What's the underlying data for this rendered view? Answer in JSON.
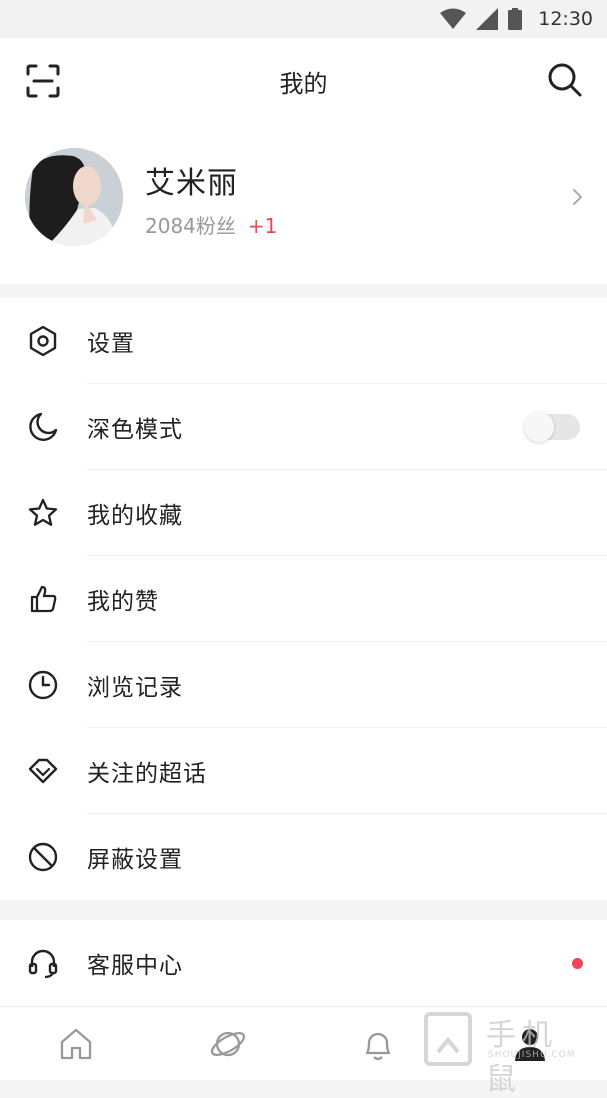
{
  "status_bar": {
    "time": "12:30",
    "icons": [
      "wifi-icon",
      "signal-icon",
      "battery-icon"
    ]
  },
  "header": {
    "title": "我的",
    "left_icon": "scan-icon",
    "right_icon": "search-icon"
  },
  "profile": {
    "name": "艾米丽",
    "followers": "2084粉丝",
    "followers_delta": "+1"
  },
  "menu": [
    {
      "label": "设置",
      "icon": "hexagon-settings-icon"
    },
    {
      "label": "深色模式",
      "icon": "moon-icon",
      "toggle_on": false
    },
    {
      "label": "我的收藏",
      "icon": "star-icon"
    },
    {
      "label": "我的赞",
      "icon": "thumbs-up-icon"
    },
    {
      "label": "浏览记录",
      "icon": "clock-icon"
    },
    {
      "label": "关注的超话",
      "icon": "diamond-icon"
    },
    {
      "label": "屏蔽设置",
      "icon": "block-icon"
    }
  ],
  "service": {
    "label": "客服中心",
    "icon": "headset-icon",
    "has_notification": true
  },
  "tabbar": {
    "items": [
      "home-icon",
      "planet-icon",
      "bell-icon",
      "user-icon"
    ],
    "active": "user-icon"
  },
  "watermark": {
    "text": "手机鼠",
    "sub": "SHOUJISHU.COM"
  },
  "colors": {
    "accent": "#e8484f",
    "dot": "#f0445a",
    "background": "#f5f5f5"
  }
}
